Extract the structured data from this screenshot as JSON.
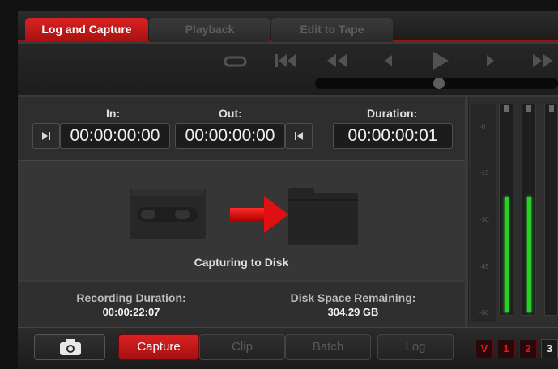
{
  "tabs": [
    {
      "label": "Log and Capture",
      "active": true
    },
    {
      "label": "Playback",
      "active": false
    },
    {
      "label": "Edit to Tape",
      "active": false
    }
  ],
  "transport": {
    "icons": [
      "loop-icon",
      "skip-to-start-icon",
      "rewind-icon",
      "step-back-icon",
      "play-icon",
      "step-forward-icon",
      "fast-forward-icon"
    ]
  },
  "timecode": {
    "in_label": "In:",
    "in_value": "00:00:00:00",
    "out_label": "Out:",
    "out_value": "00:00:00:00",
    "duration_label": "Duration:",
    "duration_value": "00:00:00:01"
  },
  "capture": {
    "status_label": "Capturing to Disk"
  },
  "info": {
    "recording_duration_label": "Recording Duration:",
    "recording_duration_value": "00:00:22:07",
    "disk_space_label": "Disk Space Remaining:",
    "disk_space_value": "304.29 GB"
  },
  "meters": {
    "scale": [
      "-0",
      "-15",
      "-30",
      "-45",
      "-60"
    ],
    "levels": [
      0.58,
      0.58
    ]
  },
  "toolbar": {
    "capture_label": "Capture",
    "clip_label": "Clip",
    "batch_label": "Batch",
    "log_label": "Log",
    "channels": [
      "V",
      "1",
      "2",
      "3"
    ]
  },
  "colors": {
    "accent": "#cc1a1a",
    "meter": "#29d02b"
  }
}
